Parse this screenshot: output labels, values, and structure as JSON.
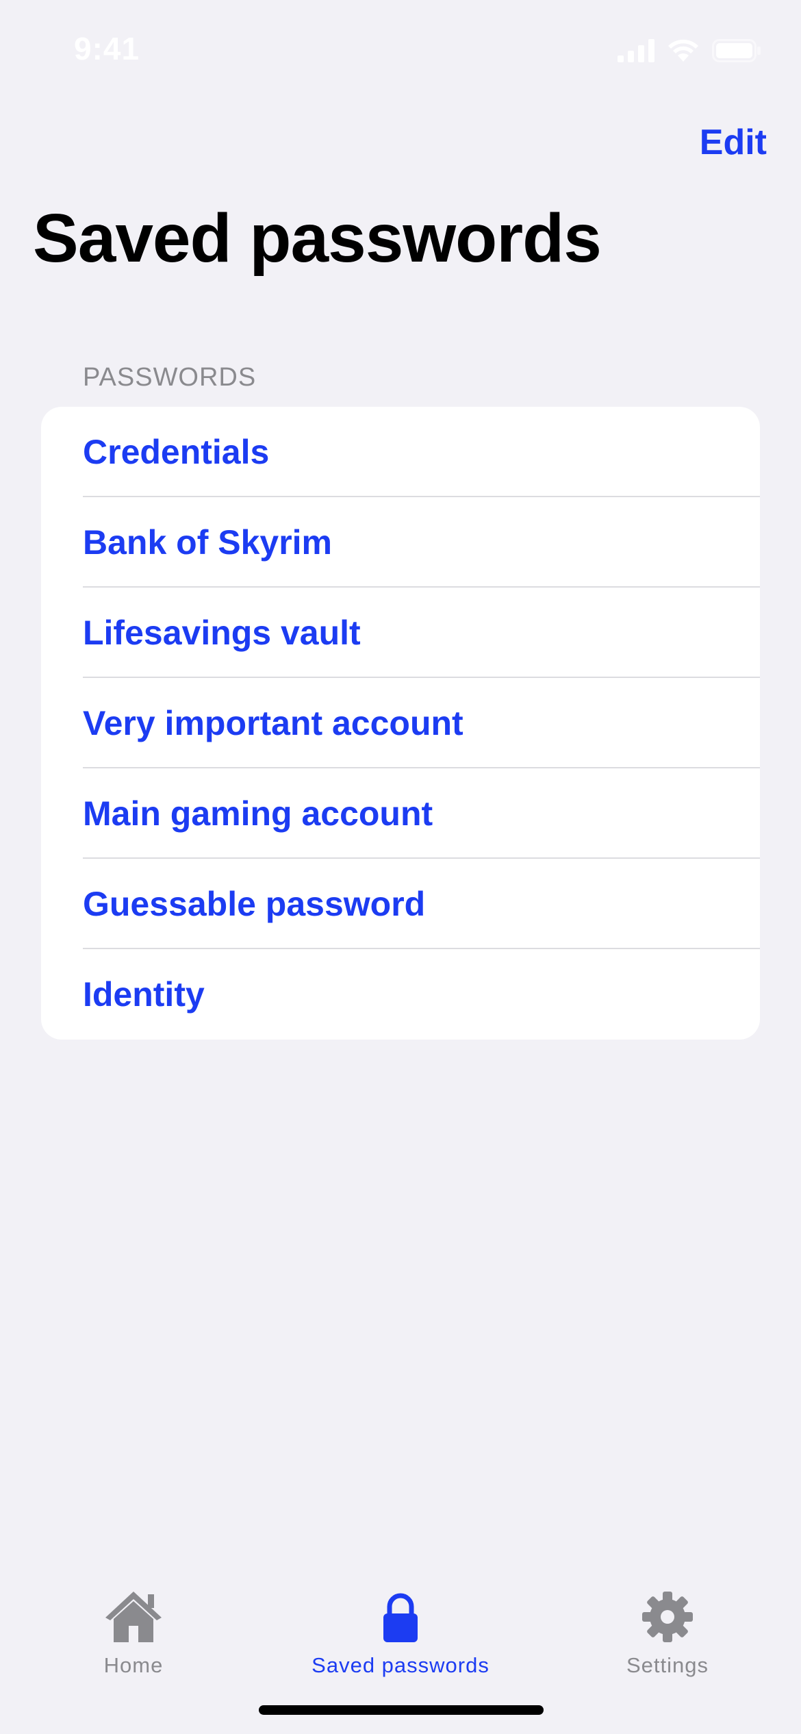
{
  "status_bar": {
    "time": "9:41"
  },
  "header": {
    "edit_label": "Edit",
    "title": "Saved passwords"
  },
  "section": {
    "header": "PASSWORDS",
    "items": [
      {
        "label": "Credentials"
      },
      {
        "label": "Bank of Skyrim"
      },
      {
        "label": "Lifesavings vault"
      },
      {
        "label": "Very important account"
      },
      {
        "label": "Main gaming account"
      },
      {
        "label": "Guessable password"
      },
      {
        "label": "Identity"
      }
    ]
  },
  "tab_bar": {
    "tabs": [
      {
        "label": "Home",
        "icon": "house-icon",
        "active": false
      },
      {
        "label": "Saved passwords",
        "icon": "lock-icon",
        "active": true
      },
      {
        "label": "Settings",
        "icon": "gear-icon",
        "active": false
      }
    ]
  },
  "colors": {
    "accent": "#1c3cf2",
    "background": "#f2f1f6",
    "inactive_tab": "#8a8a8e"
  }
}
